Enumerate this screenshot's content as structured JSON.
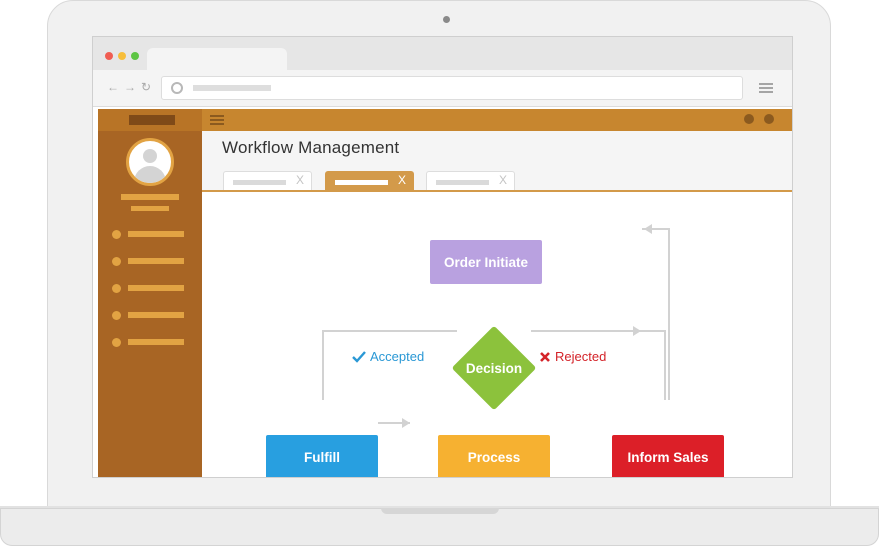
{
  "app": {
    "title": "Workflow Management"
  },
  "tabs": [
    {
      "close": "X",
      "active": false
    },
    {
      "close": "X",
      "active": true
    },
    {
      "close": "X",
      "active": false
    }
  ],
  "flowchart": {
    "nodes": {
      "order_initiate": "Order Initiate",
      "decision": "Decision",
      "fulfill": "Fulfill",
      "process": "Process",
      "inform_sales": "Inform Sales"
    },
    "edges": {
      "accepted": {
        "label": "Accepted",
        "icon": "check-icon"
      },
      "rejected": {
        "label": "Rejected",
        "icon": "cross-icon"
      }
    }
  },
  "colors": {
    "sidebar": "#a86524",
    "accent": "#c7862f",
    "order_initiate": "#b9a1e0",
    "decision": "#8cc23c",
    "fulfill": "#289fe0",
    "process": "#f6b131",
    "inform_sales": "#dc1f28",
    "accepted": "#2a98d5",
    "rejected": "#d42329",
    "connector": "#d2d2d2"
  }
}
